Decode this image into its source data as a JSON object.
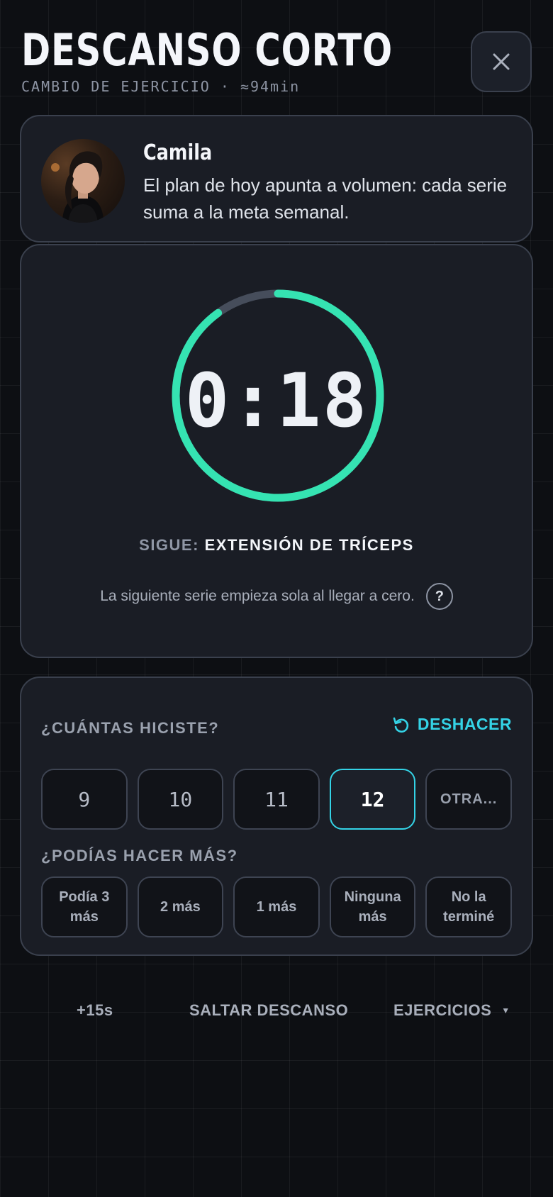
{
  "header": {
    "title": "DESCANSO CORTO",
    "subtitle": "CAMBIO DE EJERCICIO · ≈94min"
  },
  "coach": {
    "name": "Camila",
    "message": "El plan de hoy apunta a volumen: cada serie suma a la meta semanal."
  },
  "timer": {
    "display": "0:18",
    "progress_remaining": 0.9,
    "next_label": "SIGUE:",
    "next_exercise": "EXTENSIÓN DE TRÍCEPS",
    "auto_start_note": "La siguiente serie empieza sola al llegar a cero.",
    "help_glyph": "?"
  },
  "reps": {
    "question": "¿CUÁNTAS HICISTE?",
    "undo_label": "DESHACER",
    "options": [
      "9",
      "10",
      "11",
      "12",
      "OTRA..."
    ],
    "selected": "12"
  },
  "effort": {
    "question": "¿PODÍAS HACER MÁS?",
    "options": [
      "Podía 3 más",
      "2 más",
      "1 más",
      "Ninguna más",
      "No la terminé"
    ]
  },
  "bottom_bar": {
    "add_time": "+15s",
    "skip": "SALTAR DESCANSO",
    "exercises": "EJERCICIOS",
    "caret": "▼"
  },
  "colors": {
    "accent_green": "#35e3b2",
    "accent_cyan": "#34d3e6",
    "track": "#464d5b"
  },
  "icons": {
    "close": "close-icon",
    "undo": "undo-icon",
    "help": "help-icon",
    "caret": "chevron-down-icon"
  }
}
